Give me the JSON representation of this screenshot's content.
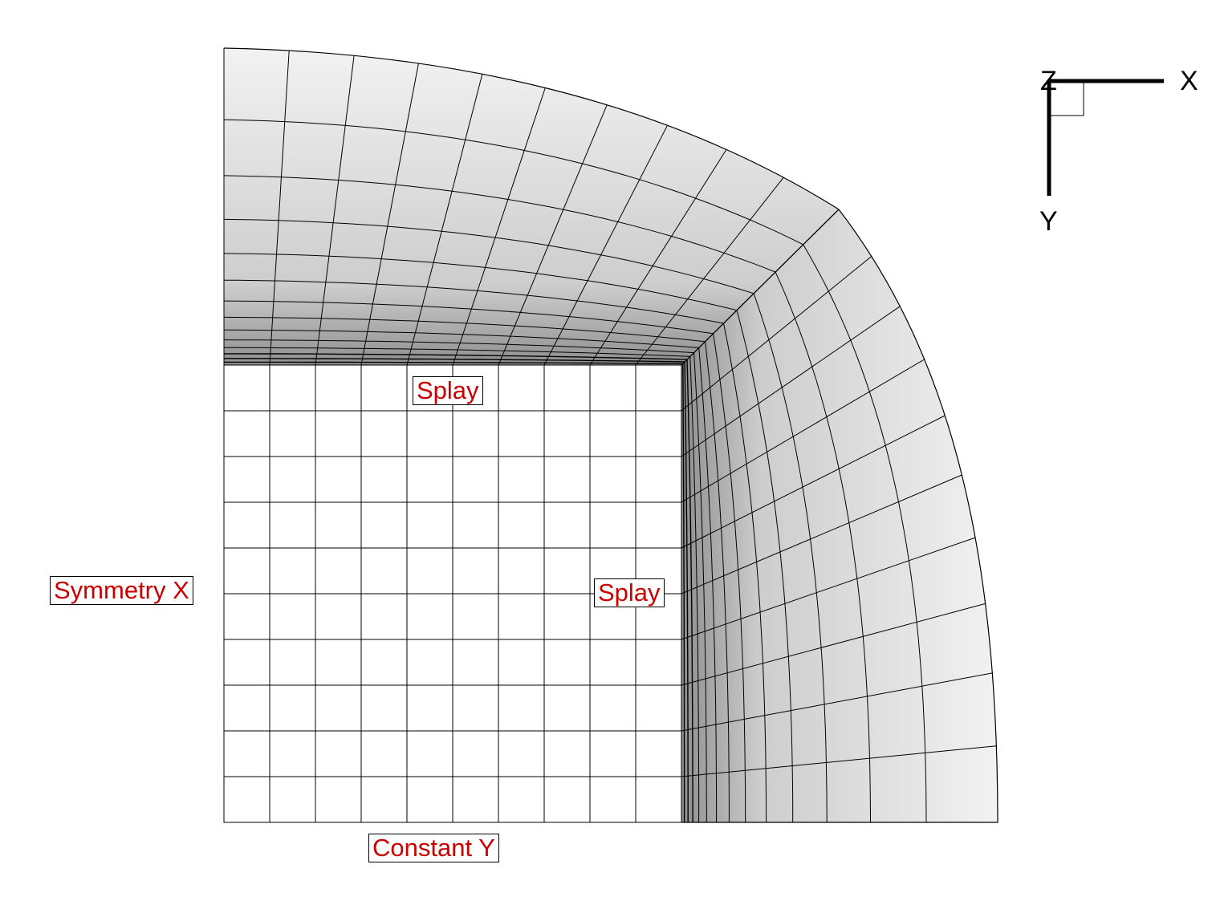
{
  "labels": {
    "splay_top": "Splay",
    "splay_right": "Splay",
    "symmetry_x": "Symmetry X",
    "constant_y": "Constant Y"
  },
  "triad": {
    "x": "X",
    "y": "Y",
    "z": "Z"
  },
  "colors": {
    "label_text": "#cc0000",
    "mesh_line": "#000000",
    "shade_dark": "#8a8a8a",
    "shade_light": "#f2f2f2"
  }
}
